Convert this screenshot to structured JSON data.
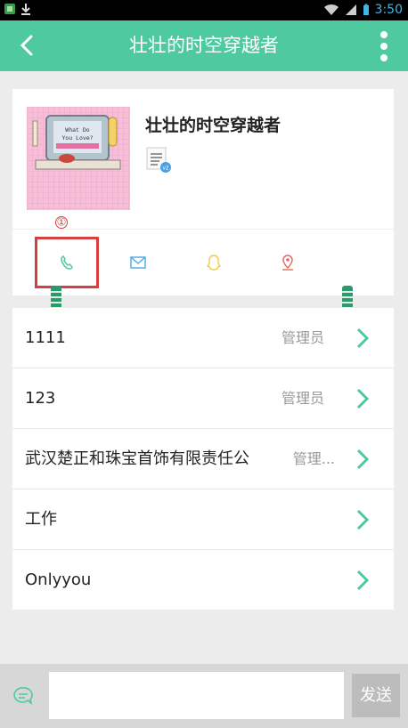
{
  "status_bar": {
    "time": "3:50",
    "icons": [
      "app-icon",
      "download-icon",
      "wifi-icon",
      "signal-icon",
      "battery-icon"
    ]
  },
  "app_bar": {
    "title": "壮壮的时空穿越者",
    "back_icon": "back-arrow-icon",
    "more_icon": "more-vertical-icon"
  },
  "profile": {
    "name": "壮壮的时空穿越者",
    "avatar_caption": "What Do You Love?",
    "doc_badge": "v2",
    "marker": "①",
    "actions": [
      {
        "icon": "phone-icon",
        "color": "#4ec9a0"
      },
      {
        "icon": "mail-icon",
        "color": "#49a8e2"
      },
      {
        "icon": "qq-icon",
        "color": "#f2c94c"
      },
      {
        "icon": "location-icon",
        "color": "#e0685e"
      }
    ]
  },
  "groups": [
    {
      "name": "1111",
      "role": "管理员"
    },
    {
      "name": "123",
      "role": "管理员"
    },
    {
      "name": "武汉楚正和珠宝首饰有限责任公",
      "role": "管理..."
    },
    {
      "name": "工作",
      "role": ""
    },
    {
      "name": "Onlyyou",
      "role": ""
    }
  ],
  "input_bar": {
    "placeholder": "",
    "send_label": "发送",
    "emoji_icon": "emoji-icon"
  },
  "colors": {
    "accent": "#4ec9a0",
    "highlight": "#d63f3f"
  }
}
